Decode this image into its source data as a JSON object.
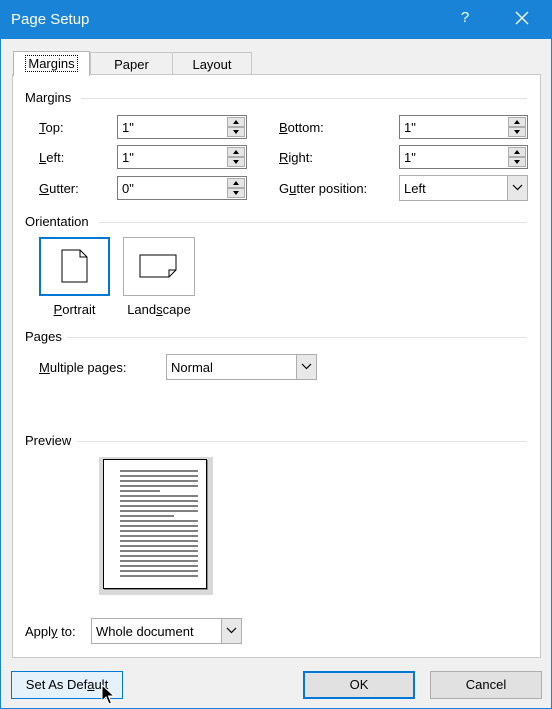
{
  "window": {
    "title": "Page Setup",
    "help": "?",
    "accent": "#1883d7"
  },
  "tabs": [
    {
      "label": "Margins",
      "active": true
    },
    {
      "label": "Paper",
      "active": false
    },
    {
      "label": "Layout",
      "active": false
    }
  ],
  "margins": {
    "group_label": "Margins",
    "top": {
      "label_u": "T",
      "label_rest": "op:",
      "value": "1\""
    },
    "left": {
      "label_u": "L",
      "label_rest": "eft:",
      "value": "1\""
    },
    "gutter": {
      "label_u": "G",
      "label_rest": "utter:",
      "value": "0\""
    },
    "bottom": {
      "label_u": "B",
      "label_rest": "ottom:",
      "value": "1\""
    },
    "right": {
      "label_u": "R",
      "label_rest": "ight:",
      "value": "1\""
    },
    "gutter_position": {
      "label_pre": "G",
      "label_u": "u",
      "label_rest": "tter position:",
      "value": "Left"
    }
  },
  "orientation": {
    "group_label": "Orientation",
    "portrait": {
      "label_u": "P",
      "label_rest": "ortrait",
      "selected": true
    },
    "landscape": {
      "label_pre": "Land",
      "label_u": "s",
      "label_rest": "cape",
      "selected": false
    }
  },
  "pages": {
    "group_label": "Pages",
    "multiple_pages": {
      "label_u": "M",
      "label_rest": "ultiple pages:",
      "value": "Normal"
    }
  },
  "preview": {
    "group_label": "Preview",
    "apply_to": {
      "label_pre": "Appl",
      "label_u": "y",
      "label_rest": " to:",
      "value": "Whole document"
    }
  },
  "buttons": {
    "set_default": {
      "label_pre": "Set As Def",
      "label_u": "a",
      "label_rest": "ult"
    },
    "ok": "OK",
    "cancel": "Cancel"
  }
}
